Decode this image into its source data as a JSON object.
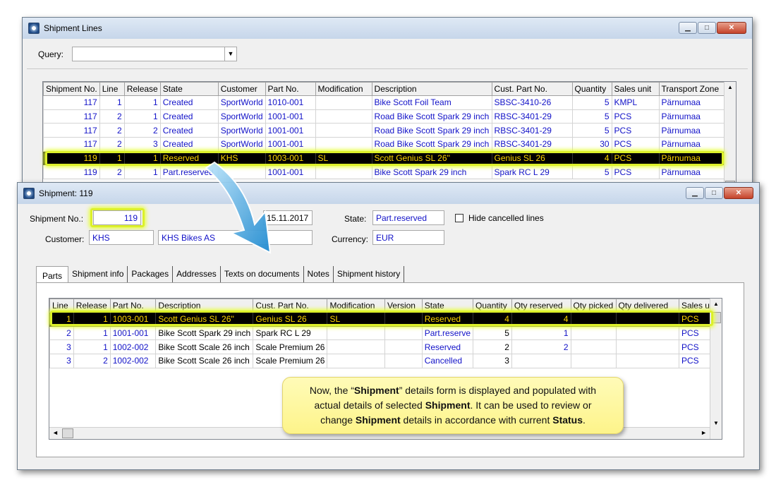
{
  "colors": {
    "link_text": "#1212c8",
    "selected_row_bg": "#000000",
    "selected_row_text": "#ffd600",
    "highlight": "#e8ff3c",
    "arrow": "#3fa4de"
  },
  "lines_window": {
    "title": "Shipment Lines",
    "query_label": "Query:",
    "query_value": "",
    "columns": [
      "Shipment No.",
      "Line",
      "Release",
      "State",
      "Customer",
      "Part No.",
      "Modification",
      "Description",
      "Cust. Part No.",
      "Quantity",
      "Sales unit",
      "Transport Zone"
    ],
    "rows": [
      [
        "117",
        "1",
        "1",
        "Created",
        "SportWorld",
        "1010-001",
        "",
        "Bike Scott Foil Team",
        "SBSC-3410-26",
        "5",
        "KMPL",
        "Pärnumaa"
      ],
      [
        "117",
        "2",
        "1",
        "Created",
        "SportWorld",
        "1001-001",
        "",
        "Road Bike Scott Spark 29 inch",
        "RBSC-3401-29",
        "5",
        "PCS",
        "Pärnumaa"
      ],
      [
        "117",
        "2",
        "2",
        "Created",
        "SportWorld",
        "1001-001",
        "",
        "Road Bike Scott Spark 29 inch",
        "RBSC-3401-29",
        "5",
        "PCS",
        "Pärnumaa"
      ],
      [
        "117",
        "2",
        "3",
        "Created",
        "SportWorld",
        "1001-001",
        "",
        "Road Bike Scott Spark 29 inch",
        "RBSC-3401-29",
        "30",
        "PCS",
        "Pärnumaa"
      ],
      [
        "119",
        "1",
        "1",
        "Reserved",
        "KHS",
        "1003-001",
        "SL",
        "Scott Genius SL 26''",
        "Genius SL 26",
        "4",
        "PCS",
        "Pärnumaa"
      ],
      [
        "119",
        "2",
        "1",
        "Part.reserved",
        "",
        "",
        "",
        "Bike Scott Spark 29 inch",
        "Spark RC L 29",
        "5",
        "PCS",
        "Pärnumaa"
      ]
    ],
    "selected_row": 4,
    "partial_part_no": "1001-001"
  },
  "shipment_window": {
    "title": "Shipment: 119",
    "shipment_no_label": "Shipment No.:",
    "shipment_no": "119",
    "date": "15.11.2017",
    "state_label": "State:",
    "state": "Part.reserved",
    "hide_cancelled_label": "Hide cancelled lines",
    "hide_cancelled_checked": false,
    "customer_label": "Customer:",
    "customer_code": "KHS",
    "customer_name": "KHS Bikes AS",
    "currency_label": "Currency:",
    "currency": "EUR",
    "tabs": [
      "Parts",
      "Shipment info",
      "Packages",
      "Addresses",
      "Texts on documents",
      "Notes",
      "Shipment history"
    ],
    "active_tab": 0,
    "columns": [
      "Line",
      "Release",
      "Part No.",
      "Description",
      "Cust. Part No.",
      "Modification",
      "Version",
      "State",
      "Quantity",
      "Qty reserved",
      "Qty picked",
      "Qty delivered",
      "Sales unit"
    ],
    "rows": [
      [
        "1",
        "1",
        "1003-001",
        "Scott Genius SL 26''",
        "Genius SL 26",
        "SL",
        "",
        "Reserved",
        "4",
        "4",
        "",
        "",
        "PCS"
      ],
      [
        "2",
        "1",
        "1001-001",
        "Bike Scott Spark 29 inch",
        "Spark RC L 29",
        "",
        "",
        "Part.reserve",
        "5",
        "1",
        "",
        "",
        "PCS"
      ],
      [
        "3",
        "1",
        "1002-002",
        "Bike Scott Scale 26 inch",
        "Scale Premium 26",
        "",
        "",
        "Reserved",
        "2",
        "2",
        "",
        "",
        "PCS"
      ],
      [
        "3",
        "2",
        "1002-002",
        "Bike Scott Scale 26 inch",
        "Scale Premium 26",
        "",
        "",
        "Cancelled",
        "3",
        "",
        "",
        "",
        "PCS"
      ]
    ],
    "selected_row": 0
  },
  "callout": {
    "line1_a": "Now, the “",
    "line1_b": "Shipment",
    "line1_c": "” details form is displayed and populated with",
    "line2_a": "actual details of selected ",
    "line2_b": "Shipment",
    ".": "",
    "line2_c": ".  It can be used to review or",
    "line3_a": "change ",
    "line3_b": "Shipment",
    "line3_c": " details in accordance with current ",
    "line3_d": "Status",
    "line3_e": "."
  }
}
